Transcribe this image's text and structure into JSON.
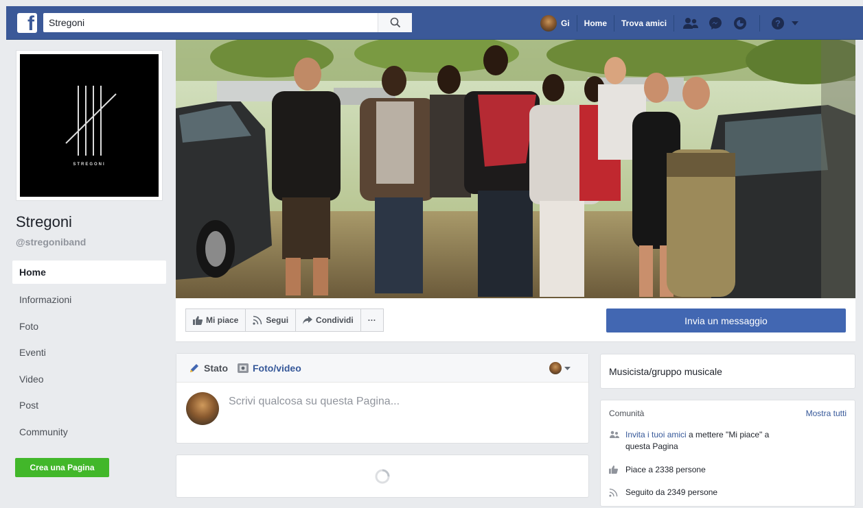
{
  "topbar": {
    "logo": "f",
    "search_value": "Stregoni",
    "user_name": "Gi",
    "links": [
      "Home",
      "Trova amici"
    ],
    "icons": [
      "friend-requests-icon",
      "messenger-icon",
      "notifications-icon",
      "help-icon",
      "caret-down-icon"
    ]
  },
  "left": {
    "page_name": "Stregoni",
    "page_handle": "@stregoniband",
    "logo_wordmark": "STREGONI",
    "nav": [
      "Home",
      "Informazioni",
      "Foto",
      "Eventi",
      "Video",
      "Post",
      "Community"
    ],
    "create_page": "Crea una Pagina"
  },
  "actions": {
    "like": "Mi piace",
    "follow": "Segui",
    "share": "Condividi",
    "more": "···",
    "message": "Invia un messaggio"
  },
  "composer": {
    "tab_status": "Stato",
    "tab_photo": "Foto/video",
    "placeholder": "Scrivi qualcosa su questa Pagina..."
  },
  "category": "Musicista/gruppo musicale",
  "community": {
    "title": "Comunità",
    "show_all": "Mostra tutti",
    "invite_link": "Invita i tuoi amici",
    "invite_rest": " a mettere \"Mi piace\" a",
    "invite_line2": "questa Pagina",
    "likes": "Piace a 2338 persone",
    "follows": "Seguito da 2349 persone"
  },
  "colors": {
    "brand": "#3b5998",
    "button_blue": "#4267b2",
    "create_green": "#42b72a",
    "link": "#365899",
    "background": "#e9ebee"
  }
}
